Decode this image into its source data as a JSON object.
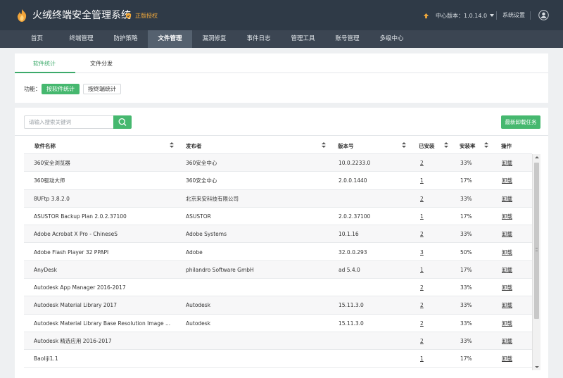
{
  "header": {
    "app_title": "火绒终端安全管理系统",
    "license_label": "正版授权",
    "version_label": "中心版本：1.0.14.0",
    "settings_label": "系统设置"
  },
  "nav": {
    "items": [
      "首页",
      "终端管理",
      "防护策略",
      "文件管理",
      "漏洞修复",
      "事件日志",
      "管理工具",
      "账号管理",
      "多级中心"
    ],
    "active": "文件管理"
  },
  "subtabs": [
    "软件统计",
    "文件分发"
  ],
  "function": {
    "label": "功能：",
    "options": [
      "按软件统计",
      "按终端统计"
    ]
  },
  "search": {
    "placeholder": "请输入搜索关键词"
  },
  "toolbar": {
    "uninstall_label": "最新卸载任务"
  },
  "table": {
    "columns": [
      "软件名称",
      "发布者",
      "版本号",
      "已安装",
      "安装率",
      "操作"
    ],
    "rows": [
      {
        "name": "360安全浏览器",
        "publisher": "360安全中心",
        "version": "10.0.2233.0",
        "installed": "2",
        "rate": "33%",
        "action": "卸载"
      },
      {
        "name": "360驱动大师",
        "publisher": "360安全中心",
        "version": "2.0.0.1440",
        "installed": "1",
        "rate": "17%",
        "action": "卸载"
      },
      {
        "name": "8UFtp 3.8.2.0",
        "publisher": "北京来安科技有限公司",
        "version": "",
        "installed": "2",
        "rate": "33%",
        "action": "卸载"
      },
      {
        "name": "ASUSTOR Backup Plan 2.0.2.37100",
        "publisher": "ASUSTOR",
        "version": "2.0.2.37100",
        "installed": "1",
        "rate": "17%",
        "action": "卸载"
      },
      {
        "name": "Adobe Acrobat X Pro - ChineseS",
        "publisher": "Adobe Systems",
        "version": "10.1.16",
        "installed": "2",
        "rate": "33%",
        "action": "卸载"
      },
      {
        "name": "Adobe Flash Player 32 PPAPI",
        "publisher": "Adobe",
        "version": "32.0.0.293",
        "installed": "3",
        "rate": "50%",
        "action": "卸载"
      },
      {
        "name": "AnyDesk",
        "publisher": "philandro Software GmbH",
        "version": "ad 5.4.0",
        "installed": "1",
        "rate": "17%",
        "action": "卸载"
      },
      {
        "name": "Autodesk App Manager 2016-2017",
        "publisher": "",
        "version": "",
        "installed": "2",
        "rate": "33%",
        "action": "卸载"
      },
      {
        "name": "Autodesk Material Library 2017",
        "publisher": "Autodesk",
        "version": "15.11.3.0",
        "installed": "2",
        "rate": "33%",
        "action": "卸载"
      },
      {
        "name": "Autodesk Material Library Base Resolution Image ...",
        "publisher": "Autodesk",
        "version": "15.11.3.0",
        "installed": "2",
        "rate": "33%",
        "action": "卸载"
      },
      {
        "name": "Autodesk 精选应用 2016-2017",
        "publisher": "",
        "version": "",
        "installed": "2",
        "rate": "33%",
        "action": "卸载"
      },
      {
        "name": "Baoliji1.1",
        "publisher": "",
        "version": "",
        "installed": "1",
        "rate": "17%",
        "action": "卸载"
      }
    ]
  },
  "colors": {
    "accent_green": "#46b86f",
    "header_bg": "#2f3a47",
    "nav_bg": "#3b4552",
    "license_orange": "#f2a93b"
  },
  "icons": [
    "flame-logo-icon",
    "shield-icon",
    "upgrade-arrow-icon",
    "user-icon",
    "search-icon",
    "sort-icon"
  ]
}
